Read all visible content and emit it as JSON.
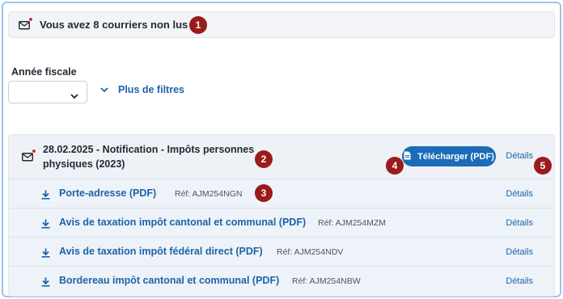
{
  "unread": {
    "message": "Vous avez 8 courriers non lus",
    "icon": "mail-unread-icon"
  },
  "filters": {
    "fiscal_year_label": "Année fiscale",
    "fiscal_year_value": "",
    "more_filters_label": "Plus de filtres"
  },
  "mail_item": {
    "title": "28.02.2025 - Notification - Impôts personnes physiques (2023)",
    "download_button_label": "Télécharger (PDF)",
    "details_label": "Détails",
    "documents": [
      {
        "name": "Porte-adresse (PDF)",
        "ref": "Réf: AJM254NGN",
        "details": "Détails"
      },
      {
        "name": "Avis de taxation impôt cantonal et communal (PDF)",
        "ref": "Réf: AJM254MZM",
        "details": "Détails"
      },
      {
        "name": "Avis de taxation impôt fédéral direct (PDF)",
        "ref": "Réf: AJM254NDV",
        "details": "Détails"
      },
      {
        "name": "Bordereau impôt cantonal et communal (PDF)",
        "ref": "Réf: AJM254NBW",
        "details": "Détails"
      }
    ]
  },
  "markers": [
    "1",
    "2",
    "3",
    "4",
    "5"
  ],
  "colors": {
    "accent": "#1b6bb8",
    "link": "#1d63a8",
    "marker": "#9a1b1b",
    "unread_dot": "#d9222a"
  }
}
